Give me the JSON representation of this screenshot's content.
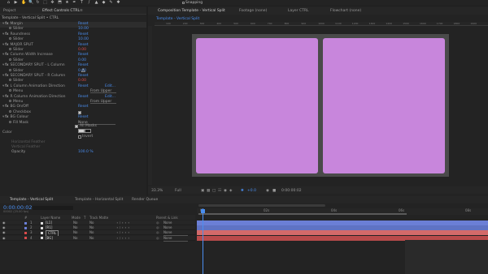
{
  "toolbar": {
    "tools": [
      "⌂",
      "▶",
      "✋",
      "🔍",
      "↻",
      "⬚",
      "✥",
      "⬒",
      "★",
      "✒",
      "T",
      "/",
      "▲",
      "◆",
      "✎",
      "✱"
    ],
    "snapping_label": "Snapping"
  },
  "project_tabs": {
    "project": "Project",
    "effect_controls": "Effect Controls CTRL",
    "menu": "≡"
  },
  "effect_controls": {
    "title": "Template - Vertical Split • CTRL",
    "rows": [
      {
        "label": "Margin",
        "fx": true,
        "v1": "Reset",
        "v1c": "blue"
      },
      {
        "label": "Slider",
        "fx": false,
        "v1": "10.00",
        "v1c": "blue"
      },
      {
        "label": "Roundness",
        "fx": true,
        "v1": "Reset",
        "v1c": "blue"
      },
      {
        "label": "Slider",
        "fx": false,
        "v1": "10.00",
        "v1c": "blue"
      },
      {
        "label": "MAJOR SPLIT",
        "fx": true,
        "v1": "Reset",
        "v1c": "blue"
      },
      {
        "label": "Slider",
        "fx": false,
        "v1": "0.00",
        "v1c": "red"
      },
      {
        "label": "Column Width Increase",
        "fx": true,
        "v1": "Reset",
        "v1c": "blue"
      },
      {
        "label": "Slider",
        "fx": false,
        "v1": "0.00",
        "v1c": "blue"
      },
      {
        "label": "SECONDARY SPLIT - L Column",
        "fx": true,
        "v1": "Reset",
        "v1c": "blue"
      },
      {
        "label": "Slider",
        "fx": false,
        "v1": "0.00",
        "v1c": "blue"
      },
      {
        "label": "SECONDARY SPLIT - R Column",
        "fx": true,
        "v1": "Reset",
        "v1c": "blue"
      },
      {
        "label": "Slider",
        "fx": false,
        "v1": "0.00",
        "v1c": "red"
      },
      {
        "label": "L Column Animation Direction",
        "fx": true,
        "v1": "Reset",
        "v1c": "blue",
        "v2": "Edit..."
      },
      {
        "label": "Menu",
        "fx": false,
        "v1": "From Upper",
        "v1c": "white",
        "dropdown": true
      },
      {
        "label": "R Column Animation Direction",
        "fx": true,
        "v1": "Reset",
        "v1c": "blue",
        "v2": "Edit..."
      },
      {
        "label": "Menu",
        "fx": false,
        "v1": "From Upper",
        "v1c": "white",
        "dropdown": true
      },
      {
        "label": "BG On/Off",
        "fx": true,
        "v1": "Reset",
        "v1c": "blue"
      },
      {
        "label": "Checkbox",
        "fx": false,
        "v1": "",
        "v1c": "white",
        "checkbox": true
      },
      {
        "label": "BG Colour",
        "fx": true,
        "v1": "Reset",
        "v1c": "blue"
      },
      {
        "label": "Fill Mask",
        "fx": false,
        "v1": "None",
        "v1c": "white",
        "dropdown": true
      }
    ],
    "all_masks": "All Masks",
    "colour_label": "Color",
    "invert": "Invert",
    "feather_label": "Horizontal Feather",
    "feather2_label": "Vertical Feather",
    "opacity_label": "Opacity",
    "opacity_value": "100.0 %"
  },
  "comp_tabs": {
    "composition": "Composition Template - Vertical Split",
    "footage": "Footage (none)",
    "layer": "Layer CTRL",
    "flowchart": "Flowchart (none)"
  },
  "comp_subtab": "Template - Vertical Split",
  "ruler_marks": [
    "100",
    "200",
    "300",
    "400",
    "500",
    "600",
    "700",
    "800",
    "900",
    "1000",
    "1100",
    "1200",
    "1300",
    "1400",
    "1500",
    "1600",
    "1700",
    "1800",
    "1900"
  ],
  "comp_footer": {
    "zoom": "33.3%",
    "resolution": "Full",
    "exposure": "+0.0",
    "timecode": "0:00:00:02"
  },
  "timeline_tabs": {
    "active": "Template - Vertical Split",
    "other": "Template - Horizontal Split",
    "render": "Render Queue"
  },
  "timeline": {
    "timecode": "0:00:00:02",
    "frames": "00002 (25.00 fps)",
    "headers": [
      "#",
      "Layer Name",
      "Mode",
      "T",
      "Track Matte",
      "Parent & Link"
    ],
    "layers": [
      {
        "num": "1",
        "name": "[L1]",
        "mode": "No",
        "matte": "No",
        "parent": "None",
        "color": "#6b7fd6"
      },
      {
        "num": "2",
        "name": "[R1]",
        "mode": "No",
        "matte": "No",
        "parent": "None",
        "color": "#6b7fd6"
      },
      {
        "num": "3",
        "name": "CTRL",
        "mode": "No",
        "matte": "No",
        "parent": "None",
        "color": "#d94b4b"
      },
      {
        "num": "4",
        "name": "[BG]",
        "mode": "No",
        "matte": "No",
        "parent": "None",
        "color": "#d94b4b"
      }
    ],
    "ticks": [
      "0s",
      "02s",
      "04s",
      "06s",
      "08s"
    ],
    "bar_colors": [
      "#6b7fd6",
      "#5f73c4",
      "#d36a6a",
      "#b94a4a"
    ]
  }
}
